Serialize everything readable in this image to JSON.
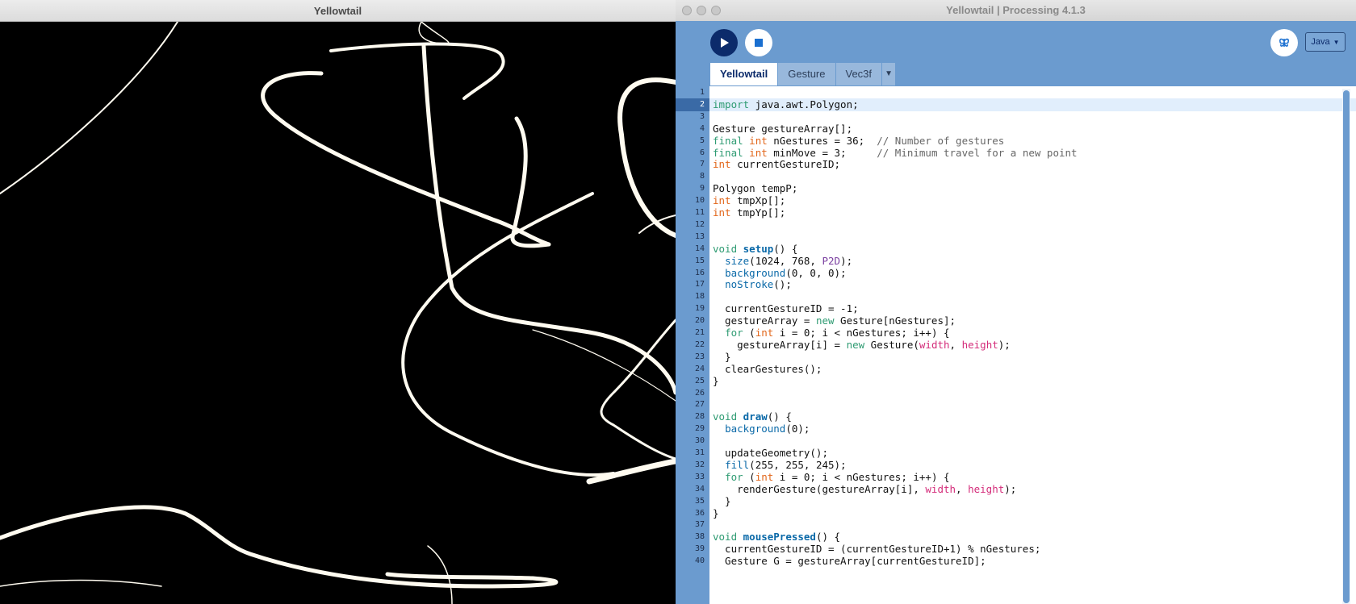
{
  "sketch_window": {
    "title": "Yellowtail"
  },
  "ide_window": {
    "title": "Yellowtail | Processing 4.1.3"
  },
  "toolbar": {
    "run_label": "Run",
    "stop_label": "Stop",
    "mode_label": "Java",
    "mode_arrow": "▼"
  },
  "tabs": [
    {
      "label": "Yellowtail",
      "active": true
    },
    {
      "label": "Gesture",
      "active": false
    },
    {
      "label": "Vec3f",
      "active": false
    }
  ],
  "tab_menu": "▼",
  "editor": {
    "current_line": 2,
    "lines": [
      {
        "n": "1",
        "text": ""
      },
      {
        "n": "2",
        "text": "import java.awt.Polygon;"
      },
      {
        "n": "3",
        "text": ""
      },
      {
        "n": "4",
        "text": "Gesture gestureArray[];"
      },
      {
        "n": "5",
        "text": "final int nGestures = 36;  // Number of gestures"
      },
      {
        "n": "6",
        "text": "final int minMove = 3;     // Minimum travel for a new point"
      },
      {
        "n": "7",
        "text": "int currentGestureID;"
      },
      {
        "n": "8",
        "text": ""
      },
      {
        "n": "9",
        "text": "Polygon tempP;"
      },
      {
        "n": "10",
        "text": "int tmpXp[];"
      },
      {
        "n": "11",
        "text": "int tmpYp[];"
      },
      {
        "n": "12",
        "text": ""
      },
      {
        "n": "13",
        "text": ""
      },
      {
        "n": "14",
        "text": "void setup() {"
      },
      {
        "n": "15",
        "text": "  size(1024, 768, P2D);"
      },
      {
        "n": "16",
        "text": "  background(0, 0, 0);"
      },
      {
        "n": "17",
        "text": "  noStroke();"
      },
      {
        "n": "18",
        "text": ""
      },
      {
        "n": "19",
        "text": "  currentGestureID = -1;"
      },
      {
        "n": "20",
        "text": "  gestureArray = new Gesture[nGestures];"
      },
      {
        "n": "21",
        "text": "  for (int i = 0; i < nGestures; i++) {"
      },
      {
        "n": "22",
        "text": "    gestureArray[i] = new Gesture(width, height);"
      },
      {
        "n": "23",
        "text": "  }"
      },
      {
        "n": "24",
        "text": "  clearGestures();"
      },
      {
        "n": "25",
        "text": "}"
      },
      {
        "n": "26",
        "text": ""
      },
      {
        "n": "27",
        "text": ""
      },
      {
        "n": "28",
        "text": "void draw() {"
      },
      {
        "n": "29",
        "text": "  background(0);"
      },
      {
        "n": "30",
        "text": ""
      },
      {
        "n": "31",
        "text": "  updateGeometry();"
      },
      {
        "n": "32",
        "text": "  fill(255, 255, 245);"
      },
      {
        "n": "33",
        "text": "  for (int i = 0; i < nGestures; i++) {"
      },
      {
        "n": "34",
        "text": "    renderGesture(gestureArray[i], width, height);"
      },
      {
        "n": "35",
        "text": "  }"
      },
      {
        "n": "36",
        "text": "}"
      },
      {
        "n": "37",
        "text": ""
      },
      {
        "n": "38",
        "text": "void mousePressed() {"
      },
      {
        "n": "39",
        "text": "  currentGestureID = (currentGestureID+1) % nGestures;"
      },
      {
        "n": "40",
        "text": "  Gesture G = gestureArray[currentGestureID];"
      }
    ]
  },
  "colors": {
    "ide_background": "#6b9bcf",
    "run_button": "#0c2b6b",
    "keyword_green": "#2e9b72",
    "keyword_orange": "#e2661a",
    "function_blue": "#0a69a8",
    "constant_pink": "#d42c7a",
    "comment_gray": "#666666"
  }
}
